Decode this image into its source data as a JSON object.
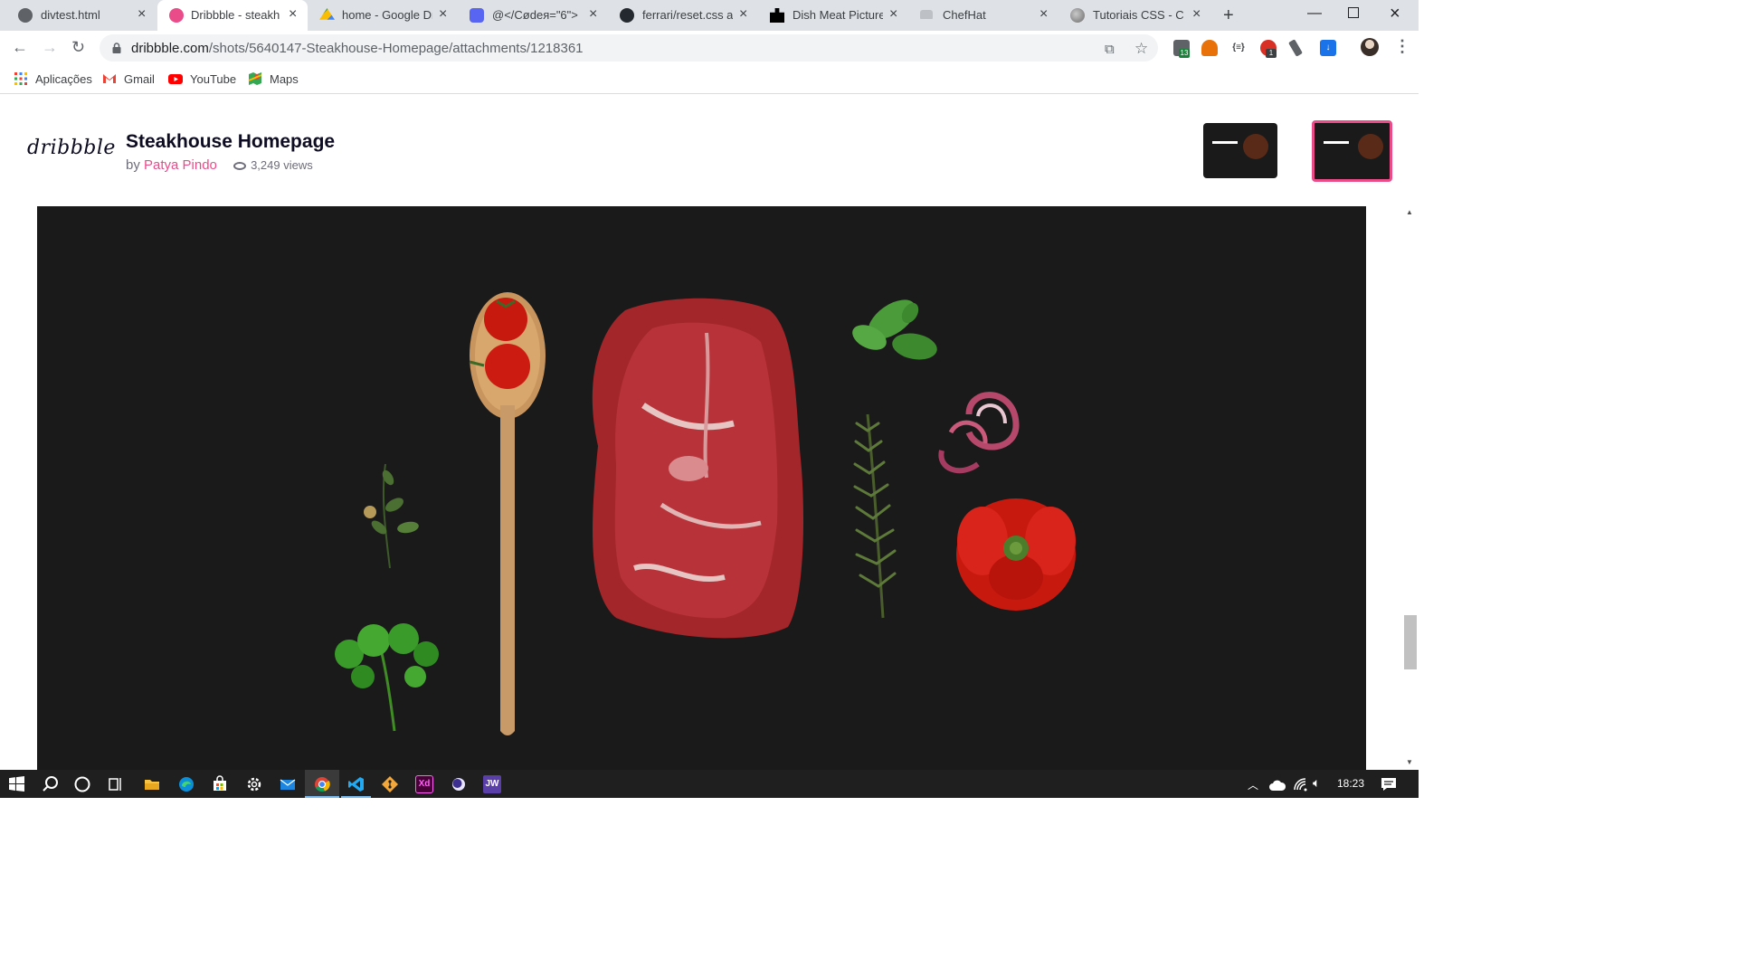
{
  "tabs": [
    {
      "title": "divtest.html",
      "active": false
    },
    {
      "title": "Dribbble - steakhouse",
      "active": true
    },
    {
      "title": "home - Google Drive",
      "active": false
    },
    {
      "title": "@</Cødeя=\"6\">",
      "active": false
    },
    {
      "title": "ferrari/reset.css at",
      "active": false
    },
    {
      "title": "Dish Meat Pictures",
      "active": false
    },
    {
      "title": "ChefHat",
      "active": false
    },
    {
      "title": "Tutoriais CSS - Con",
      "active": false
    }
  ],
  "address_bar": {
    "domain": "dribbble.com",
    "path": "/shots/5640147-Steakhouse-Homepage/attachments/1218361"
  },
  "extensions": [
    {
      "name": "extension-1",
      "badge": "13",
      "color": "#5f6368"
    },
    {
      "name": "extension-2",
      "badge": "",
      "color": "#e8710a"
    },
    {
      "name": "extension-3",
      "badge": "",
      "color": "#3c4043"
    },
    {
      "name": "extension-4",
      "badge": "1",
      "color": "#d93025"
    },
    {
      "name": "extension-5",
      "badge": "",
      "color": "#5f6368"
    },
    {
      "name": "extension-6",
      "badge": "",
      "color": "#1a73e8"
    }
  ],
  "bookmarks": [
    {
      "label": "Aplicações",
      "icon": "apps-grid-icon"
    },
    {
      "label": "Gmail",
      "icon": "gmail-icon"
    },
    {
      "label": "YouTube",
      "icon": "youtube-icon"
    },
    {
      "label": "Maps",
      "icon": "maps-icon"
    }
  ],
  "shot": {
    "logo": "dribbble",
    "title": "Steakhouse Homepage",
    "by_label": "by",
    "author": "Patya Pindo",
    "views": "3,249 views",
    "image_alt": "Raw ribeye steak with tomatoes on a wooden spoon, herbs, rosemary, red onion and red pepper on a black background"
  },
  "taskbar": {
    "time": "18:23",
    "apps": [
      "windows-start-icon",
      "search-icon",
      "cortana-icon",
      "task-view-icon",
      "file-explorer-icon",
      "edge-icon",
      "store-icon",
      "settings-icon",
      "mail-icon",
      "chrome-icon",
      "vscode-icon",
      "git-icon",
      "xd-icon",
      "app-icon",
      "jw-icon"
    ]
  },
  "colors": {
    "accent": "#ea4c89",
    "shot_background": "#1b1a1a",
    "chrome_tabstrip": "#dee1e6"
  }
}
